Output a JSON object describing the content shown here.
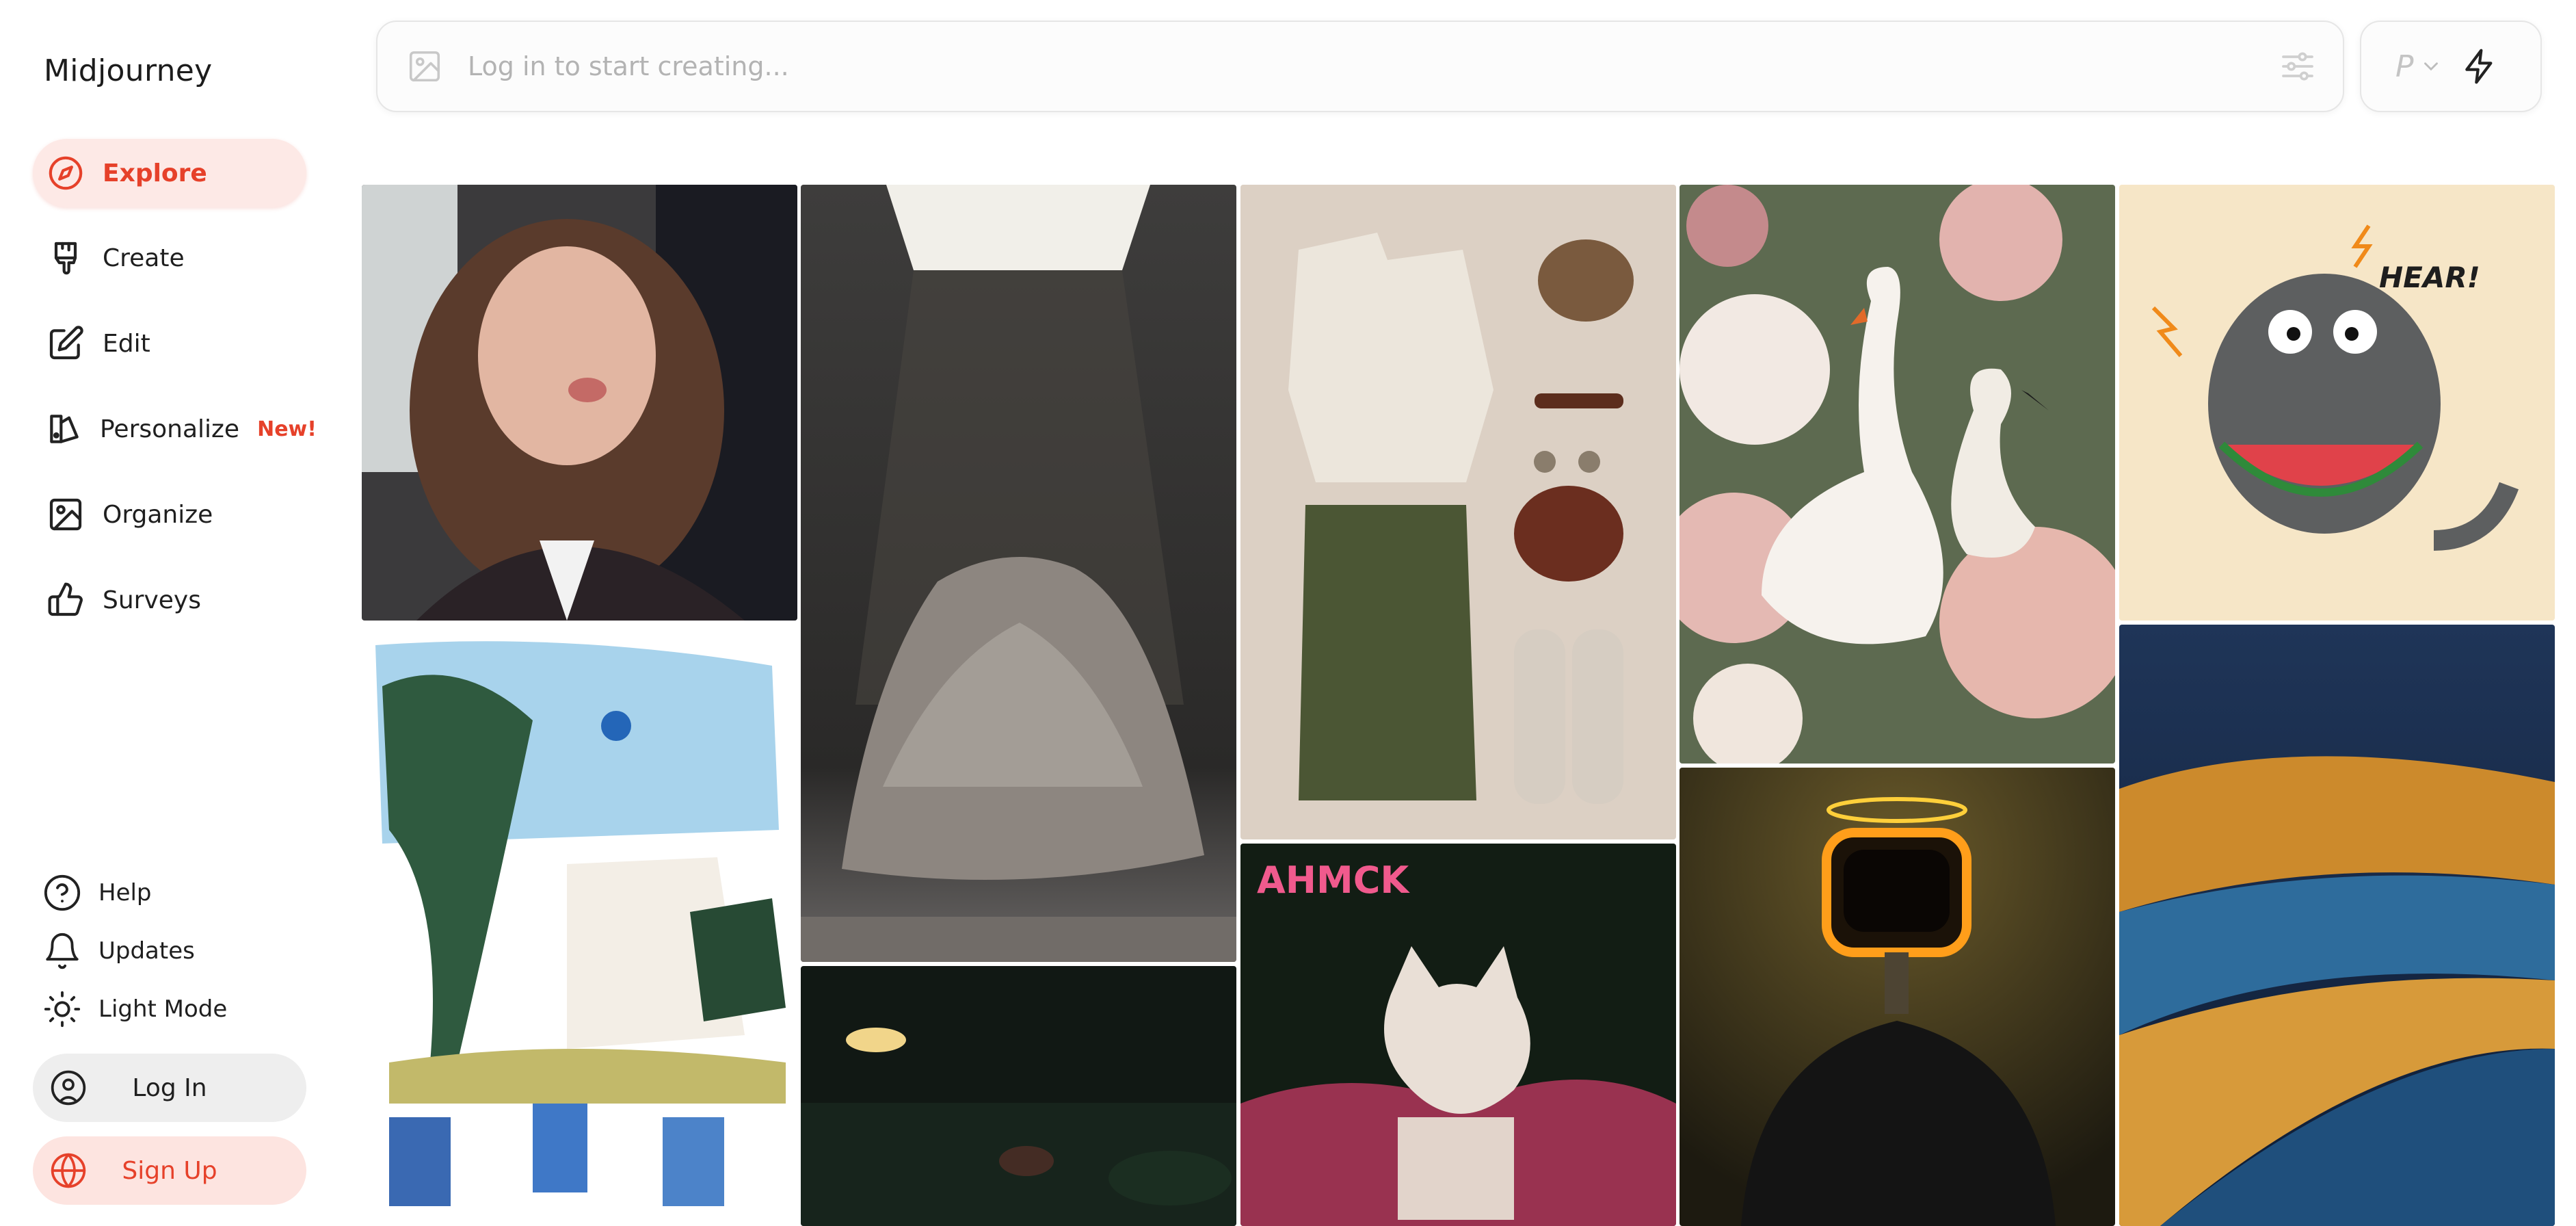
{
  "brand": "Midjourney",
  "nav": {
    "explore": "Explore",
    "create": "Create",
    "edit": "Edit",
    "personalize": "Personalize",
    "personalize_badge": "New!",
    "organize": "Organize",
    "surveys": "Surveys"
  },
  "footer": {
    "help": "Help",
    "updates": "Updates",
    "light_mode": "Light Mode",
    "login": "Log In",
    "signup": "Sign Up"
  },
  "prompt": {
    "placeholder": "Log in to start creating..."
  },
  "mode": {
    "personalize_letter": "P"
  },
  "gallery": {
    "monster_text": "HEAR!",
    "poster_title": "AHMCK"
  },
  "colors": {
    "accent": "#e6412a",
    "accent_bg": "#fde9e6"
  }
}
